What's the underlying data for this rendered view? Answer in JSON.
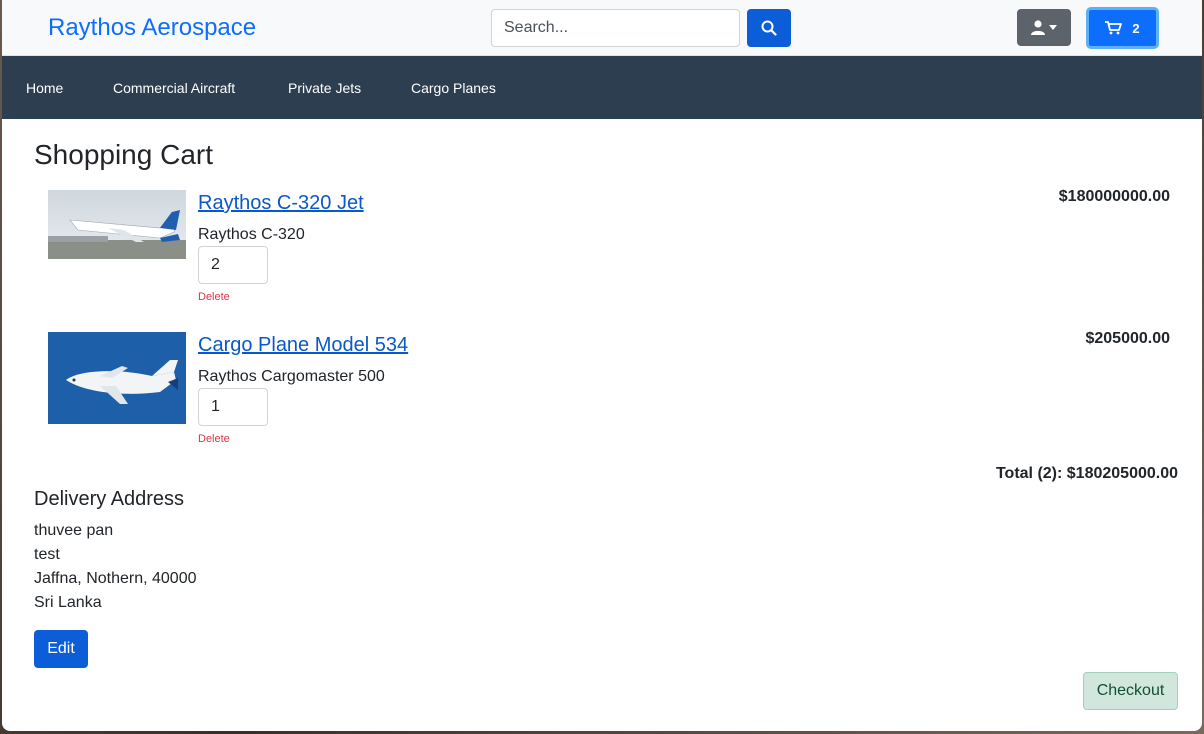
{
  "header": {
    "brand": "Raythos Aerospace",
    "search_placeholder": "Search...",
    "cart_count": "2"
  },
  "nav": {
    "items": [
      "Home",
      "Commercial Aircraft",
      "Private Jets",
      "Cargo Planes"
    ]
  },
  "cart": {
    "title": "Shopping Cart",
    "items": [
      {
        "name": "Raythos C-320 Jet",
        "model": "Raythos C-320",
        "quantity": "2",
        "delete_label": "Delete",
        "price": "$180000000.00",
        "image": "jet-photo"
      },
      {
        "name": "Cargo Plane Model 534",
        "model": "Raythos Cargomaster 500",
        "quantity": "1",
        "delete_label": "Delete",
        "price": "$205000.00",
        "image": "cargo-plane-photo"
      }
    ],
    "total": "Total (2): $180205000.00"
  },
  "delivery": {
    "heading": "Delivery Address",
    "lines": [
      "thuvee pan",
      "test",
      "Jaffna, Nothern, 40000",
      "Sri Lanka"
    ],
    "edit_label": "Edit"
  },
  "checkout_label": "Checkout",
  "colors": {
    "brand": "#0d6efd",
    "navbar": "#2c3e50",
    "primary_button": "#0b5ed7",
    "delete": "#dc3545",
    "checkout_bg": "#d1e7dd"
  }
}
